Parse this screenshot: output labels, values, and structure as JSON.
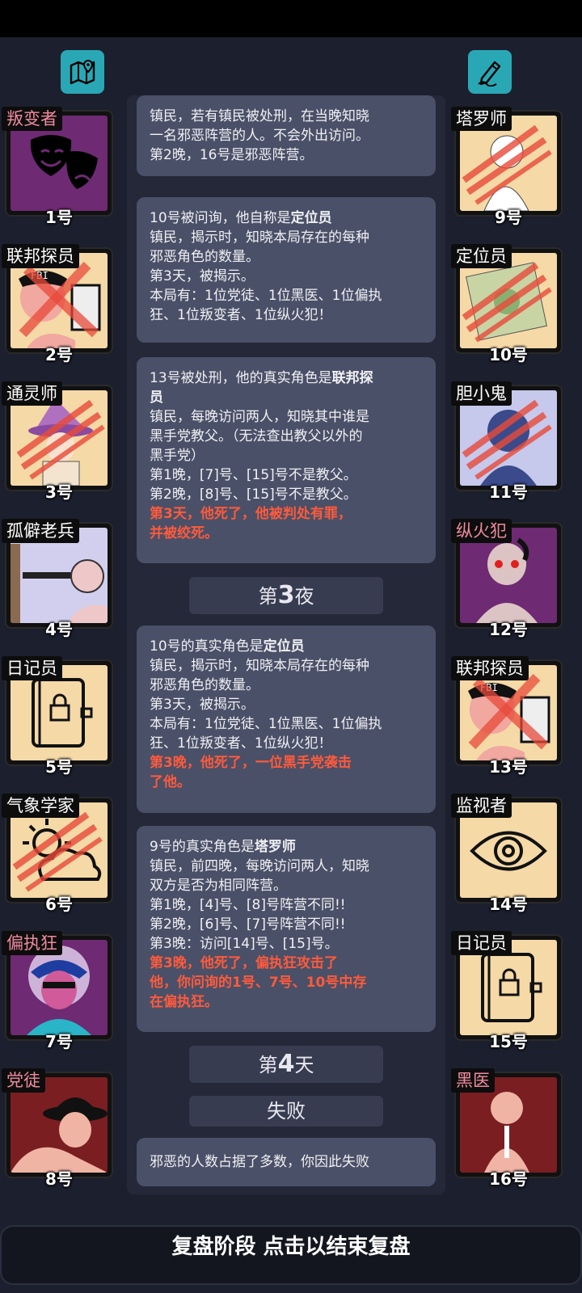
{
  "colors": {
    "background": "#1c1f2e",
    "panel": "#4a5067",
    "accent": "#2aa7b4",
    "evil_label": "#f08aa0",
    "death_text": "#ff5a3c"
  },
  "toolbar": {
    "map_icon": "map-pin-icon",
    "notes_icon": "pencil-note-icon"
  },
  "left_players": [
    {
      "role": "叛变者",
      "number": "1号",
      "evil": true,
      "dead": false
    },
    {
      "role": "联邦探员",
      "number": "2号",
      "evil": false,
      "dead": true
    },
    {
      "role": "通灵师",
      "number": "3号",
      "evil": false,
      "dead": true
    },
    {
      "role": "孤僻老兵",
      "number": "4号",
      "evil": false,
      "dead": false
    },
    {
      "role": "日记员",
      "number": "5号",
      "evil": false,
      "dead": false
    },
    {
      "role": "气象学家",
      "number": "6号",
      "evil": false,
      "dead": true
    },
    {
      "role": "偏执狂",
      "number": "7号",
      "evil": true,
      "dead": false
    },
    {
      "role": "党徒",
      "number": "8号",
      "evil": true,
      "dead": false
    }
  ],
  "right_players": [
    {
      "role": "塔罗师",
      "number": "9号",
      "evil": false,
      "dead": true
    },
    {
      "role": "定位员",
      "number": "10号",
      "evil": false,
      "dead": true
    },
    {
      "role": "胆小鬼",
      "number": "11号",
      "evil": false,
      "dead": true
    },
    {
      "role": "纵火犯",
      "number": "12号",
      "evil": true,
      "dead": false
    },
    {
      "role": "联邦探员",
      "number": "13号",
      "evil": false,
      "dead": true
    },
    {
      "role": "监视者",
      "number": "14号",
      "evil": false,
      "dead": false
    },
    {
      "role": "日记员",
      "number": "15号",
      "evil": false,
      "dead": false
    },
    {
      "role": "黑医",
      "number": "16号",
      "evil": true,
      "dead": false
    }
  ],
  "log": {
    "e0": {
      "l1": "镇民，若有镇民被处刑，在当晚知晓",
      "l2": "一名邪恶阵营的人。不会外出访问。",
      "l3": "第2晚，16号是邪恶阵营。"
    },
    "e1": {
      "head": "10号被问询，他自称是",
      "role": "定位员",
      "l1": "镇民，揭示时，知晓本局存在的每种",
      "l2": "邪恶角色的数量。",
      "l3": "第3天，被揭示。",
      "l4": "本局有：1位党徒、1位黑医、1位偏执",
      "l5": "狂、1位叛变者、1位纵火犯！"
    },
    "e2": {
      "head": "13号被处刑，他的真实角色是",
      "role1": "联邦探",
      "role2": "员",
      "l1": "镇民，每晚访问两人，知晓其中谁是",
      "l2": "黑手党教父。（无法查出教父以外的",
      "l3": "黑手党）",
      "l4": "第1晚，[7]号、[15]号不是教父。",
      "l5": "第2晚，[8]号、[15]号不是教父。",
      "d1": "第3天，他死了，他被判处有罪，",
      "d2": "并被绞死。"
    },
    "phase_night": {
      "pre": "第",
      "num": "3",
      "post": "夜"
    },
    "e3": {
      "head": "10号的真实角色是",
      "role": "定位员",
      "l1": "镇民，揭示时，知晓本局存在的每种",
      "l2": "邪恶角色的数量。",
      "l3": "第3天，被揭示。",
      "l4": "本局有：1位党徒、1位黑医、1位偏执",
      "l5": "狂、1位叛变者、1位纵火犯！",
      "d1": "第3晚，他死了，一位黑手党袭击",
      "d2": "了他。"
    },
    "e4": {
      "head": "9号的真实角色是",
      "role": "塔罗师",
      "l1": "镇民，前四晚，每晚访问两人，知晓",
      "l2": "双方是否为相同阵营。",
      "l3": "第1晚，[4]号、[8]号阵营不同!!",
      "l4": "第2晚，[6]号、[7]号阵营不同!!",
      "l5": "第3晚：访问[14]号、[15]号。",
      "d1": "第3晚，他死了，偏执狂攻击了",
      "d2": "他，你问询的1号、7号、10号中存",
      "d3": "在偏执狂。"
    },
    "phase_day": {
      "pre": "第",
      "num": "4",
      "post": "天"
    },
    "result": "失败",
    "final": "邪恶的人数占据了多数，你因此失败"
  },
  "bottom_bar": "复盘阶段 点击以结束复盘"
}
